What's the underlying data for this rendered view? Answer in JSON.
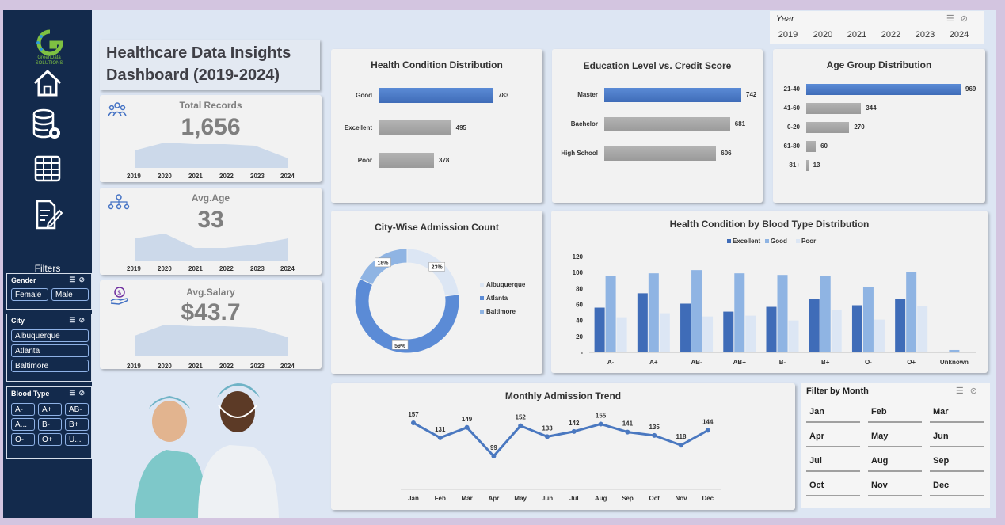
{
  "sidebar": {
    "logo_text_line1": "GreenData",
    "logo_text_line2": "SOLUTIONS",
    "filters_title": "Filters",
    "gender": {
      "title": "Gender",
      "options": [
        "Female",
        "Male"
      ]
    },
    "city": {
      "title": "City",
      "options": [
        "Albuquerque",
        "Atlanta",
        "Baltimore"
      ]
    },
    "blood_type": {
      "title": "Blood Type",
      "options": [
        "A-",
        "A+",
        "AB-",
        "A...",
        "B-",
        "B+",
        "O-",
        "O+",
        "U..."
      ]
    }
  },
  "header": {
    "title_line1": "Healthcare Data Insights",
    "title_line2": "Dashboard (2019-2024)"
  },
  "kpis": {
    "total_records": {
      "label": "Total Records",
      "value": "1,656"
    },
    "avg_age": {
      "label": "Avg.Age",
      "value": "33"
    },
    "avg_salary": {
      "label": "Avg.Salary",
      "value": "$43.7"
    },
    "years": [
      "2019",
      "2020",
      "2021",
      "2022",
      "2023",
      "2024"
    ]
  },
  "year_slicer": {
    "title": "Year",
    "options": [
      "2019",
      "2020",
      "2021",
      "2022",
      "2023",
      "2024"
    ]
  },
  "month_slicer": {
    "title": "Filter by Month",
    "options": [
      "Jan",
      "Feb",
      "Mar",
      "Apr",
      "May",
      "Jun",
      "Jul",
      "Aug",
      "Sep",
      "Oct",
      "Nov",
      "Dec"
    ]
  },
  "colors": {
    "accent_blue": "#4472c4",
    "gray_bar": "#a6a6a6",
    "sidebar": "#132a4c",
    "light_blue": "#8fb4e3",
    "pale_blue": "#dce6f4"
  },
  "chart_data": [
    {
      "type": "bar",
      "title": "Health Condition Distribution",
      "categories": [
        "Good",
        "Excellent",
        "Poor"
      ],
      "values": [
        783,
        495,
        378
      ]
    },
    {
      "type": "bar",
      "title": "Education Level vs. Credit Score",
      "categories": [
        "Master",
        "Bachelor",
        "High School"
      ],
      "values": [
        742,
        681,
        606
      ]
    },
    {
      "type": "bar",
      "title": "Age Group Distribution",
      "categories": [
        "21-40",
        "41-60",
        "0-20",
        "61-80",
        "81+"
      ],
      "values": [
        969,
        344,
        270,
        60,
        13
      ]
    },
    {
      "type": "pie",
      "title": "City-Wise Admission Count",
      "categories": [
        "Albuquerque",
        "Atlanta",
        "Baltimore"
      ],
      "values": [
        23,
        59,
        18
      ],
      "labels": [
        "23%",
        "59%",
        "18%"
      ]
    },
    {
      "type": "bar",
      "title": "Health Condition by Blood Type Distribution",
      "categories": [
        "A-",
        "A+",
        "AB-",
        "AB+",
        "B-",
        "B+",
        "O-",
        "O+",
        "Unknown"
      ],
      "series": [
        {
          "name": "Excellent",
          "values": [
            56,
            74,
            61,
            51,
            57,
            67,
            59,
            67,
            1
          ]
        },
        {
          "name": "Good",
          "values": [
            96,
            99,
            103,
            99,
            97,
            96,
            82,
            101,
            3
          ]
        },
        {
          "name": "Poor",
          "values": [
            44,
            49,
            45,
            46,
            40,
            53,
            41,
            58,
            1
          ]
        }
      ],
      "yticks": [
        "-",
        "20",
        "40",
        "60",
        "80",
        "100",
        "120"
      ],
      "ylim": [
        0,
        120
      ],
      "legend": "top"
    },
    {
      "type": "line",
      "title": "Monthly Admission Trend",
      "categories": [
        "Jan",
        "Feb",
        "Mar",
        "Apr",
        "May",
        "Jun",
        "Jul",
        "Aug",
        "Sep",
        "Oct",
        "Nov",
        "Dec"
      ],
      "values": [
        157,
        131,
        149,
        99,
        152,
        133,
        142,
        155,
        141,
        135,
        118,
        144
      ]
    }
  ]
}
